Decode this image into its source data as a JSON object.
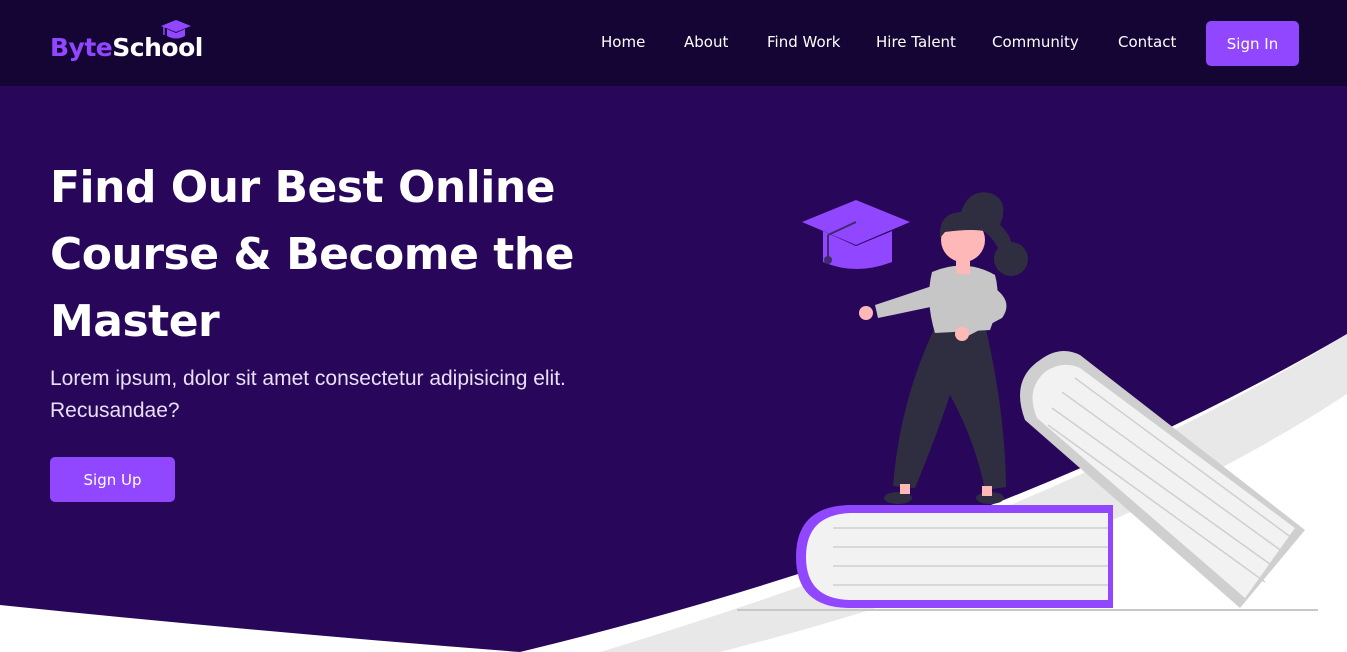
{
  "brand": {
    "part1": "Byte",
    "part2": "School",
    "accent": "#9147ff",
    "nav_bg": "#150535",
    "hero_bg": "#28065a"
  },
  "nav": {
    "links": [
      "Home",
      "About",
      "Find Work",
      "Hire Talent",
      "Community",
      "Contact"
    ],
    "signin_label": "Sign In"
  },
  "hero": {
    "title": "Find Our Best Online Course & Become the Master",
    "subtitle": "Lorem ipsum, dolor sit amet consectetur adipisicing elit. Recusandae?",
    "signup_label": "Sign Up"
  },
  "icons": {
    "logo_cap": "graduation-cap-icon",
    "illustration": "student-on-books-illustration"
  }
}
